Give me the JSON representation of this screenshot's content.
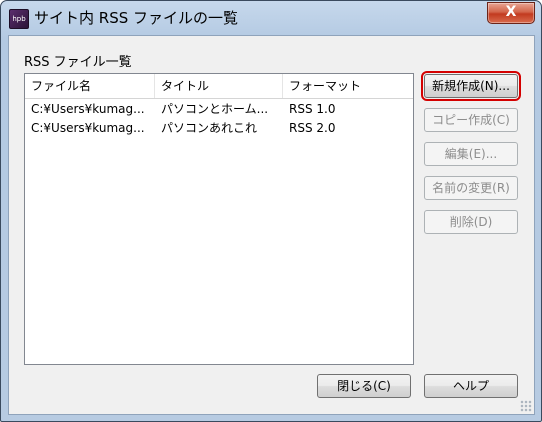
{
  "window": {
    "title": "サイト内 RSS ファイルの一覧",
    "app_icon_text": "hpb",
    "close_glyph": "X"
  },
  "group_label": "RSS ファイル一覧",
  "list": {
    "columns": [
      "ファイル名",
      "タイトル",
      "フォーマット"
    ],
    "rows": [
      [
        "C:¥Users¥kumag...",
        "パソコンとホーム...",
        "RSS 1.0"
      ],
      [
        "C:¥Users¥kumag...",
        "パソコンあれこれ",
        "RSS 2.0"
      ]
    ]
  },
  "buttons": {
    "new": "新規作成(N)...",
    "copy": "コピー作成(C)",
    "edit": "編集(E)...",
    "rename": "名前の変更(R)",
    "delete": "削除(D)",
    "close": "閉じる(C)",
    "help": "ヘルプ"
  },
  "colors": {
    "title_bg": "#b9cde4",
    "close_red": "#c74a2f",
    "focus_highlight": "#d40000"
  }
}
